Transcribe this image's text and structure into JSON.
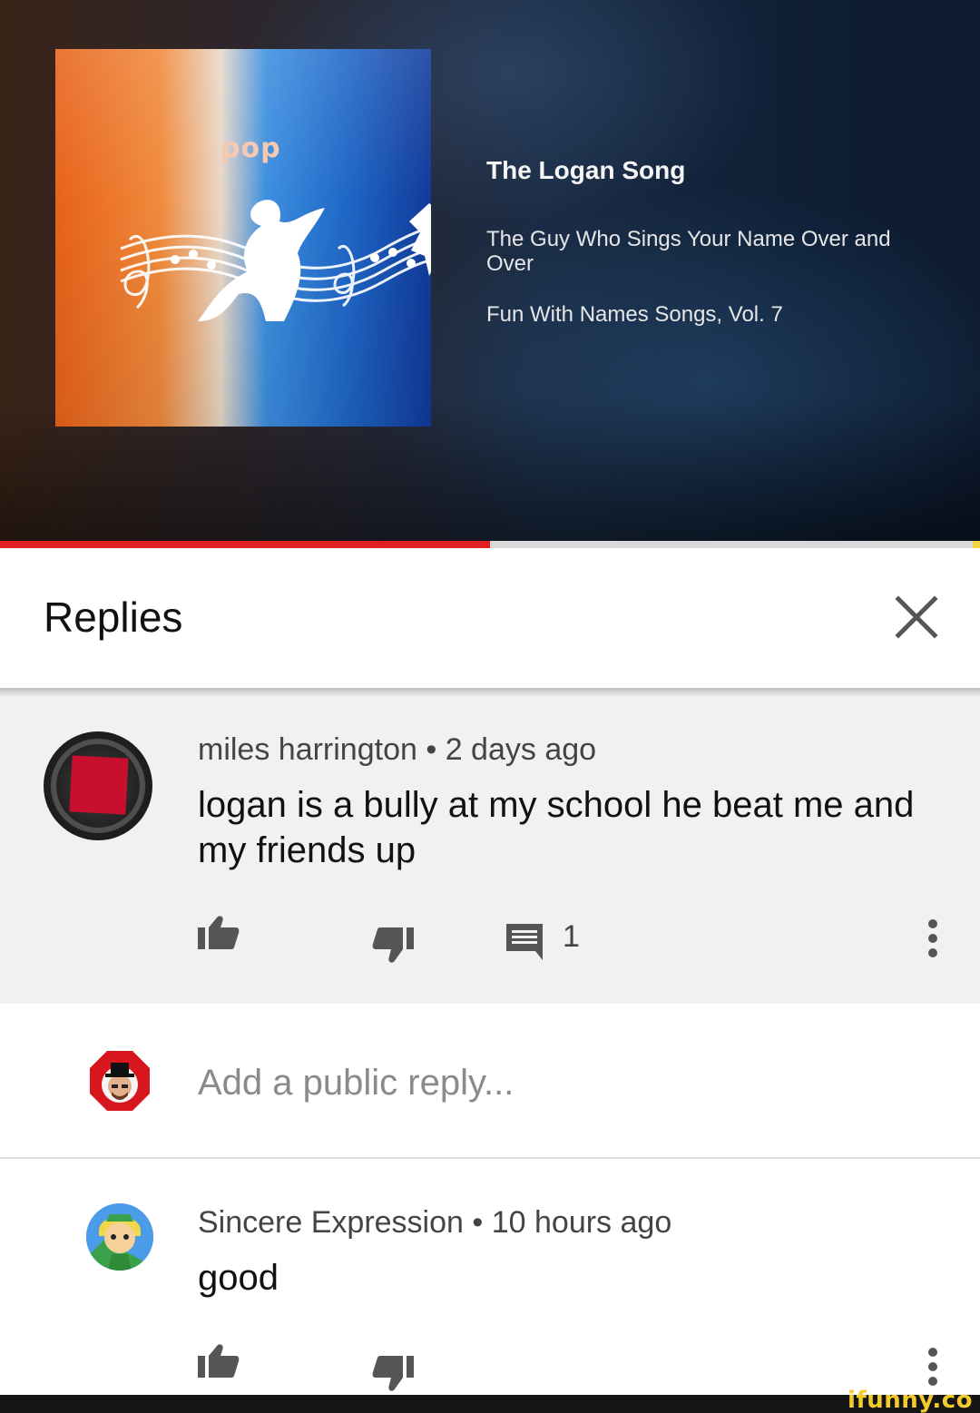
{
  "video": {
    "album_label": "pop",
    "song_title": "The Logan Song",
    "artist": "The Guy Who Sings Your Name Over and Over",
    "album": "Fun With Names Songs, Vol. 7",
    "progress": 0.5,
    "progress_color": "#e02020"
  },
  "replies_panel": {
    "title": "Replies",
    "close_icon": "close-icon"
  },
  "main_comment": {
    "author": "miles harrington",
    "separator": "•",
    "time": "2 days ago",
    "text": "logan is a bully at my school he beat me and my friends up",
    "reply_count": "1",
    "icons": [
      "thumbs-up-icon",
      "thumbs-down-icon",
      "comment-icon",
      "more-vert-icon"
    ]
  },
  "add_reply": {
    "placeholder": "Add a public reply..."
  },
  "reply": {
    "author": "Sincere Expression",
    "separator": "•",
    "time": "10 hours ago",
    "text": "good",
    "icons": [
      "thumbs-up-icon",
      "thumbs-down-icon",
      "more-vert-icon"
    ]
  },
  "watermark": "ifunny.co"
}
